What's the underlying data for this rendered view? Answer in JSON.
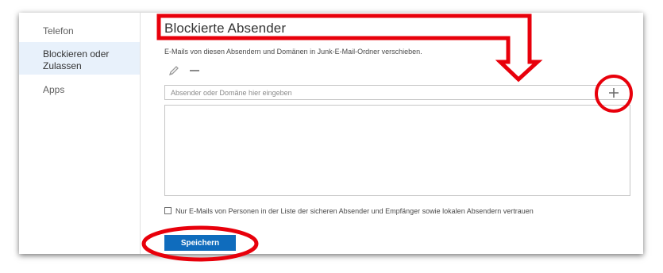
{
  "sidebar": {
    "items": [
      {
        "label": "Telefon",
        "active": false
      },
      {
        "label": "Blockieren oder\nZulassen",
        "active": true
      },
      {
        "label": "Apps",
        "active": false
      }
    ]
  },
  "main": {
    "title": "Blockierte Absender",
    "description": "E-Mails von diesen Absendern und Domänen in Junk-E-Mail-Ordner verschieben.",
    "toolbar": {
      "edit_icon": "pencil-icon",
      "remove_icon": "minus-icon"
    },
    "sender_input": {
      "placeholder": "Absender oder Domäne hier eingeben",
      "value": ""
    },
    "add_icon": "plus-icon",
    "blocked_list": [],
    "trust_checkbox": {
      "checked": false,
      "label": "Nur E-Mails von Personen in der Liste der sicheren Absender und Empfänger sowie lokalen Absendern vertrauen"
    },
    "save_label": "Speichern"
  },
  "annotations": {
    "color": "#e8000b",
    "shapes": [
      "callout-arrow-outline",
      "circle-around-add",
      "ellipse-around-save"
    ]
  },
  "colors": {
    "accent": "#0f6cbd",
    "selected_nav": "#e8f1fb"
  }
}
